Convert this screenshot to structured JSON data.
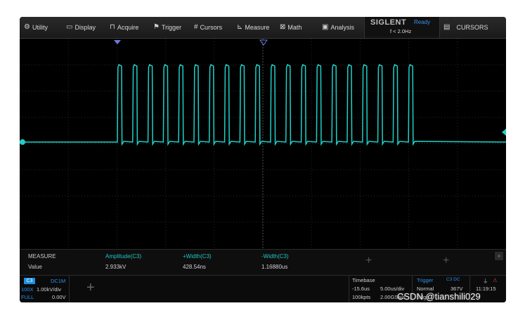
{
  "menu": {
    "items": [
      {
        "label": "Utility",
        "icon": "gear-icon"
      },
      {
        "label": "Display",
        "icon": "monitor-icon"
      },
      {
        "label": "Acquire",
        "icon": "acquire-icon"
      },
      {
        "label": "Trigger",
        "icon": "flag-icon"
      },
      {
        "label": "Cursors",
        "icon": "hash-icon"
      },
      {
        "label": "Measure",
        "icon": "measure-icon"
      },
      {
        "label": "Math",
        "icon": "math-icon"
      },
      {
        "label": "Analysis",
        "icon": "analysis-icon"
      }
    ],
    "brand": "SIGLENT",
    "run_state": "Ready",
    "frequency": "f < 2.0Hz",
    "right_label": "CURSORS",
    "right_icon": "list-icon"
  },
  "waveform": {
    "color": "#1fd0c8",
    "channel_marker_color": "#1fd0c8",
    "trigger_marker_color": "#6a7bd8",
    "pulse_count": 20
  },
  "measure": {
    "title": "MEASURE",
    "row_label": "Value",
    "columns": [
      {
        "name": "Amplitude(C3)",
        "value": "2.933kV"
      },
      {
        "name": "+Width(C3)",
        "value": "428.54ns"
      },
      {
        "name": "-Width(C3)",
        "value": "1.16880us"
      }
    ]
  },
  "channel": {
    "name": "C3",
    "coupling": "DC1M",
    "probe": "100X",
    "scale": "1.00kV/div",
    "bandwidth": "FULL",
    "offset": "0.00V"
  },
  "timebase": {
    "title": "Timebase",
    "delay": "-15.6us",
    "scale": "5.00us/div",
    "memory": "100kpts",
    "sample_rate": "2.00GSa/s"
  },
  "trigger": {
    "title": "Trigger",
    "source": "C3 DC",
    "mode": "Normal",
    "level": "367V",
    "edge": "Edge"
  },
  "clock": {
    "time": "11:19:15"
  },
  "watermark": "CSDN @tianshili029"
}
